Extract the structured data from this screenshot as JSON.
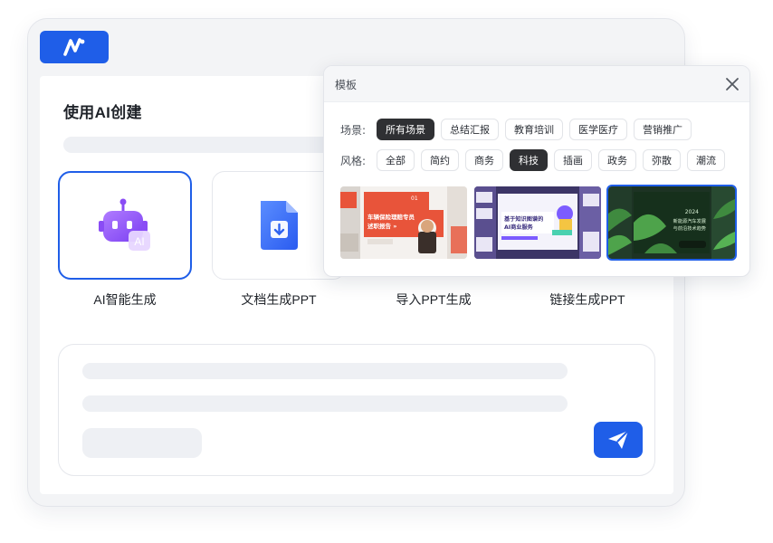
{
  "app": {
    "title": "使用AI创建"
  },
  "modes": [
    {
      "label": "AI智能生成",
      "selected": true,
      "icon": "robot-ai-icon"
    },
    {
      "label": "文档生成PPT",
      "selected": false,
      "icon": "document-icon"
    },
    {
      "label": "导入PPT生成",
      "selected": false,
      "icon": "import-icon"
    },
    {
      "label": "链接生成PPT",
      "selected": false,
      "icon": "link-icon"
    }
  ],
  "robot_badge": "AI",
  "template_panel": {
    "title": "模板",
    "scene_label": "场景:",
    "scenes": [
      "所有场景",
      "总结汇报",
      "教育培训",
      "医学医疗",
      "营销推广"
    ],
    "scene_active": "所有场景",
    "style_label": "风格:",
    "styles": [
      "全部",
      "简约",
      "商务",
      "科技",
      "插画",
      "政务",
      "弥散",
      "潮流"
    ],
    "style_active": "科技",
    "thumbnails": [
      {
        "text": "车辆保险理赔专员\n述职报告",
        "tag": "01",
        "theme": "orange",
        "selected": false
      },
      {
        "text": "基于知识图谱的\nAI商业服务",
        "tag": "",
        "theme": "purple",
        "selected": false
      },
      {
        "text": "2024\n新能源汽车发展\n与前沿技术趋势",
        "tag": "",
        "theme": "green",
        "selected": true
      }
    ]
  },
  "colors": {
    "accent": "#1f5ee8",
    "active_chip": "#2f3033"
  }
}
